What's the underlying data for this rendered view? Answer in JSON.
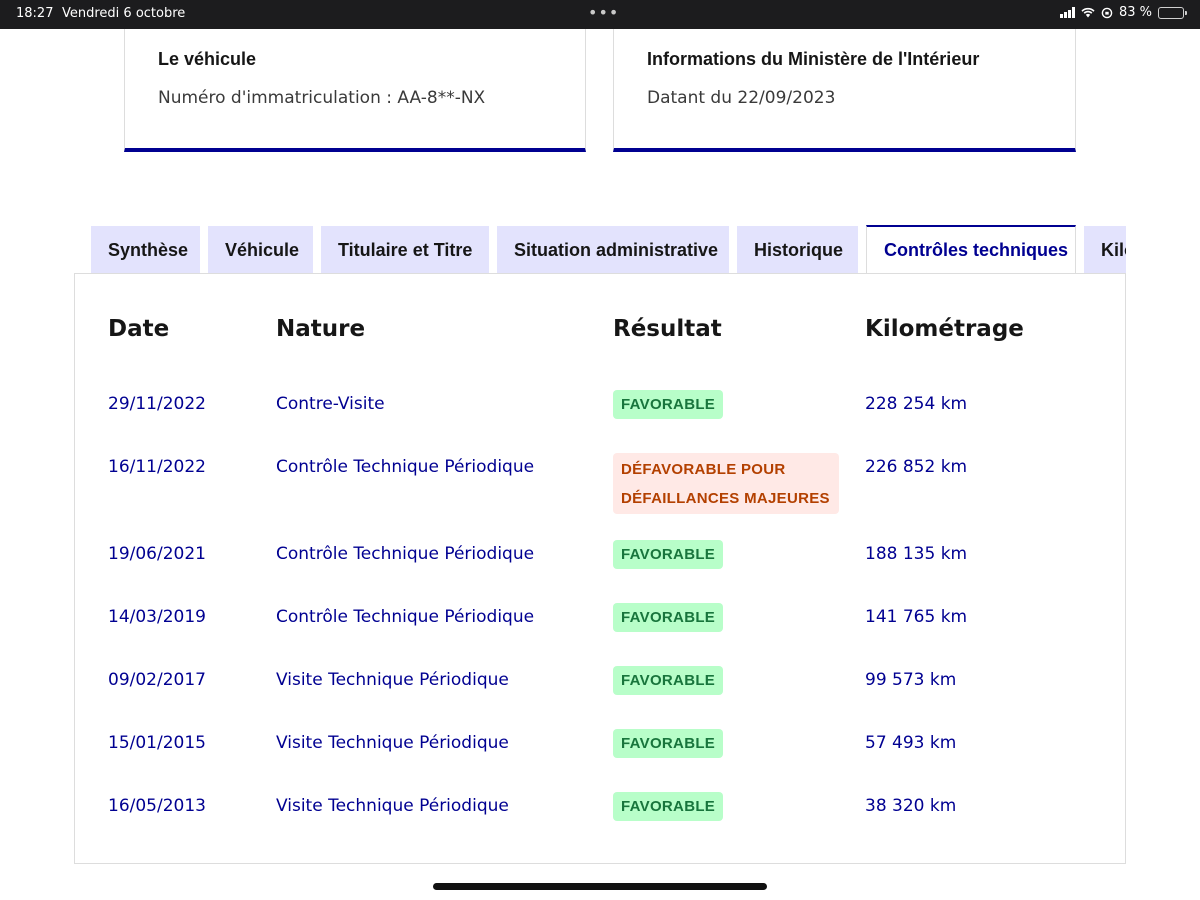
{
  "statusbar": {
    "time": "18:27",
    "date": "Vendredi 6 octobre",
    "battery": "83 %",
    "battery_level": 0.83
  },
  "cards": [
    {
      "title": "Le véhicule",
      "text": "Numéro d'immatriculation : AA-8**-NX"
    },
    {
      "title": "Informations du Ministère de l'Intérieur",
      "text": "Datant du 22/09/2023"
    }
  ],
  "tabs": [
    "Synthèse",
    "Véhicule",
    "Titulaire et Titre",
    "Situation administrative",
    "Historique",
    "Contrôles techniques",
    "Kilométrage"
  ],
  "active_tab": "Contrôles techniques",
  "table": {
    "headers": [
      "Date",
      "Nature",
      "Résultat",
      "Kilométrage"
    ],
    "rows": [
      {
        "date": "29/11/2022",
        "nature": "Contre-Visite",
        "result": "FAVORABLE",
        "status": "ok",
        "km": "228 254 km"
      },
      {
        "date": "16/11/2022",
        "nature": "Contrôle Technique Périodique",
        "result_lines": [
          "DÉFAVORABLE POUR",
          "DÉFAILLANCES MAJEURES"
        ],
        "status": "ko",
        "km": "226 852 km"
      },
      {
        "date": "19/06/2021",
        "nature": "Contrôle Technique Périodique",
        "result": "FAVORABLE",
        "status": "ok",
        "km": "188 135 km"
      },
      {
        "date": "14/03/2019",
        "nature": "Contrôle Technique Périodique",
        "result": "FAVORABLE",
        "status": "ok",
        "km": "141 765 km"
      },
      {
        "date": "09/02/2017",
        "nature": "Visite Technique Périodique",
        "result": "FAVORABLE",
        "status": "ok",
        "km": "99 573 km"
      },
      {
        "date": "15/01/2015",
        "nature": "Visite Technique Périodique",
        "result": "FAVORABLE",
        "status": "ok",
        "km": "57 493 km"
      },
      {
        "date": "16/05/2013",
        "nature": "Visite Technique Périodique",
        "result": "FAVORABLE",
        "status": "ok",
        "km": "38 320 km"
      }
    ]
  },
  "colors": {
    "primary": "#000091",
    "tab_bg": "#e3e3fd",
    "success_bg": "#b8fec9",
    "success_text": "#18753c",
    "error_bg": "#ffe9e6",
    "error_text": "#b34000"
  }
}
